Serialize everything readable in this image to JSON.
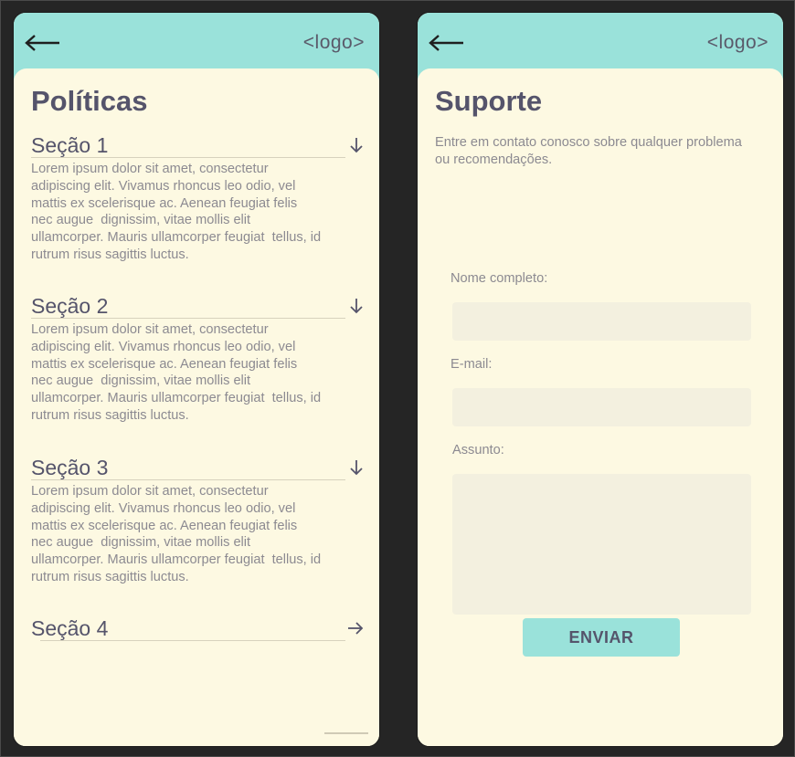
{
  "policies": {
    "header": {
      "back_icon": "arrow-left-icon",
      "logo": "<logo>"
    },
    "title": "Políticas",
    "sections": [
      {
        "label": "Seção 1",
        "icon": "arrow-down-icon",
        "body": "Lorem ipsum dolor sit amet, consectetur\nadipiscing elit. Vivamus rhoncus leo odio, vel\nmattis ex scelerisque ac. Aenean feugiat felis\nnec augue  dignissim, vitae mollis elit\nullamcorper. Mauris ullamcorper feugiat  tellus, id\nrutrum risus sagittis luctus."
      },
      {
        "label": "Seção 2",
        "icon": "arrow-down-icon",
        "body": "Lorem ipsum dolor sit amet, consectetur\nadipiscing elit. Vivamus rhoncus leo odio, vel\nmattis ex scelerisque ac. Aenean feugiat felis\nnec augue  dignissim, vitae mollis elit\nullamcorper. Mauris ullamcorper feugiat  tellus, id\nrutrum risus sagittis luctus."
      },
      {
        "label": "Seção 3",
        "icon": "arrow-down-icon",
        "body": "Lorem ipsum dolor sit amet, consectetur\nadipiscing elit. Vivamus rhoncus leo odio, vel\nmattis ex scelerisque ac. Aenean feugiat felis\nnec augue  dignissim, vitae mollis elit\nullamcorper. Mauris ullamcorper feugiat  tellus, id\nrutrum risus sagittis luctus."
      },
      {
        "label": "Seção 4",
        "icon": "arrow-right-icon",
        "body": ""
      }
    ]
  },
  "support": {
    "header": {
      "back_icon": "arrow-left-icon",
      "logo": "<logo>"
    },
    "title": "Suporte",
    "subtitle": "Entre em contato conosco sobre qualquer problema ou recomendações.",
    "form": {
      "name_label": "Nome completo:",
      "name_value": "",
      "email_label": "E-mail:",
      "email_value": "",
      "subject_label": "Assunto:",
      "subject_value": "",
      "submit_label": "ENVIAR"
    }
  },
  "colors": {
    "header": "#9ae2da",
    "background": "#fdf9e2",
    "input": "#f3f0df",
    "title_text": "#55546b",
    "body_text": "#8c8a91"
  }
}
